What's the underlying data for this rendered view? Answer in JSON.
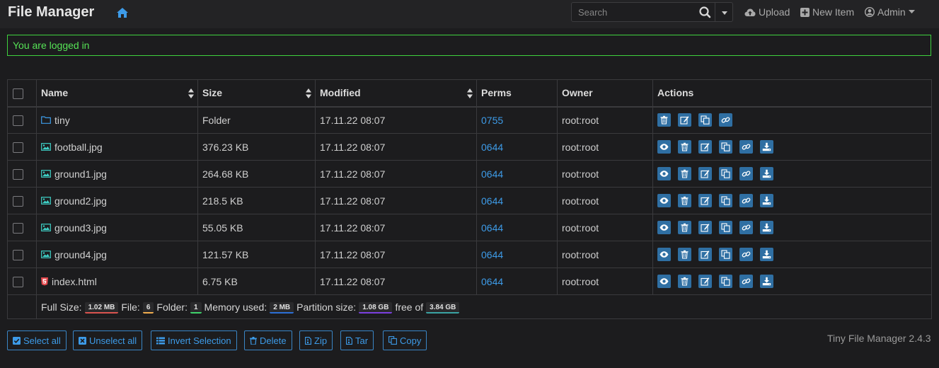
{
  "app": {
    "title": "File Manager"
  },
  "nav": {
    "search_placeholder": "Search",
    "upload": "Upload",
    "new_item": "New Item",
    "user": "Admin"
  },
  "alert": {
    "message": "You are logged in"
  },
  "table": {
    "headers": {
      "name": "Name",
      "size": "Size",
      "modified": "Modified",
      "perms": "Perms",
      "owner": "Owner",
      "actions": "Actions"
    },
    "rows": [
      {
        "name": "tiny",
        "type": "folder",
        "size": "Folder",
        "modified": "17.11.22 08:07",
        "perms": "0755",
        "owner": "root:root"
      },
      {
        "name": "football.jpg",
        "type": "image",
        "size": "376.23 KB",
        "modified": "17.11.22 08:07",
        "perms": "0644",
        "owner": "root:root"
      },
      {
        "name": "ground1.jpg",
        "type": "image",
        "size": "264.68 KB",
        "modified": "17.11.22 08:07",
        "perms": "0644",
        "owner": "root:root"
      },
      {
        "name": "ground2.jpg",
        "type": "image",
        "size": "218.5 KB",
        "modified": "17.11.22 08:07",
        "perms": "0644",
        "owner": "root:root"
      },
      {
        "name": "ground3.jpg",
        "type": "image",
        "size": "55.05 KB",
        "modified": "17.11.22 08:07",
        "perms": "0644",
        "owner": "root:root"
      },
      {
        "name": "ground4.jpg",
        "type": "image",
        "size": "121.57 KB",
        "modified": "17.11.22 08:07",
        "perms": "0644",
        "owner": "root:root"
      },
      {
        "name": "index.html",
        "type": "html",
        "size": "6.75 KB",
        "modified": "17.11.22 08:07",
        "perms": "0644",
        "owner": "root:root"
      }
    ],
    "footer": {
      "full_size_label": "Full Size:",
      "full_size": "1.02 MB",
      "file_label": "File:",
      "file_count": "6",
      "folder_label": "Folder:",
      "folder_count": "1",
      "memory_label": "Memory used:",
      "memory": "2 MB",
      "partition_label": "Partition size:",
      "partition": "1.08 GB",
      "free_label": "free of",
      "free_total": "3.84 GB"
    }
  },
  "buttons": {
    "select_all": "Select all",
    "unselect_all": "Unselect all",
    "invert": "Invert Selection",
    "delete": "Delete",
    "zip": "Zip",
    "tar": "Tar",
    "copy": "Copy"
  },
  "version": "Tiny File Manager 2.4.3",
  "colors": {
    "accent": "#3d9be8",
    "alert_green": "#3ed13e",
    "action_button": "#2f6fa3",
    "badge_full_size": "#d9534f",
    "badge_file": "#f0ad4e",
    "badge_folder": "#3fd36b",
    "badge_memory": "#2b6fd6",
    "badge_partition": "#7b3fe0",
    "badge_free": "#3aa3a3"
  }
}
